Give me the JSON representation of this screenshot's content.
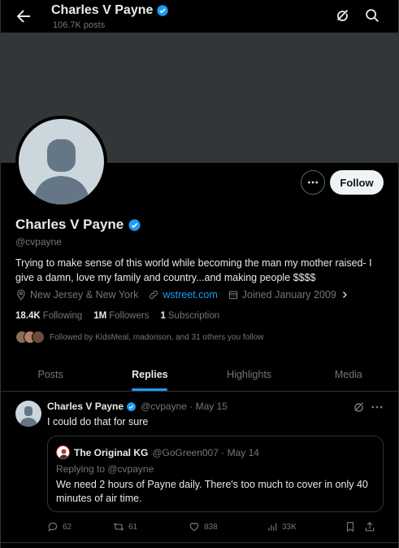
{
  "header": {
    "name": "Charles V Payne",
    "posts": "106.7K posts"
  },
  "profile": {
    "name": "Charles V Payne",
    "handle": "@cvpayne",
    "bio": "Trying to make sense of this world while becoming the man my mother raised- I give a damn, love my family and country...and making people $$$$",
    "location": "New Jersey & New York",
    "website": "wstreet.com",
    "joined": "Joined January 2009",
    "follow_label": "Follow"
  },
  "stats": {
    "following_count": "18.4K",
    "following_label": "Following",
    "followers_count": "1M",
    "followers_label": "Followers",
    "subscription_count": "1",
    "subscription_label": "Subscription"
  },
  "followed_by": "Followed by KidsMeal, madorison, and 31 others you follow",
  "tabs": [
    {
      "label": "Posts"
    },
    {
      "label": "Replies"
    },
    {
      "label": "Highlights"
    },
    {
      "label": "Media"
    }
  ],
  "tweet": {
    "name": "Charles V Payne",
    "handle_date": "@cvpayne · May 15",
    "text": "I could do that for sure",
    "quote": {
      "name": "The Original KG",
      "handle_date": "@GoGreen007 · May 14",
      "replying_label": "Replying to ",
      "replying_handle": "@cvpayne",
      "text": "We need 2 hours of Payne daily.  There's too much to cover in only 40 minutes of air time."
    },
    "actions": {
      "replies": "62",
      "reposts": "61",
      "likes": "838",
      "views": "33K"
    }
  },
  "colors": {
    "accent": "#1d9bf0",
    "verified": "#1d9bf0",
    "background": "#000000",
    "muted": "#71767b"
  },
  "icons": [
    "back-arrow-icon",
    "verified-badge-icon",
    "grok-icon",
    "search-icon",
    "more-icon",
    "location-icon",
    "link-icon",
    "calendar-icon",
    "chevron-right-icon",
    "reply-icon",
    "repost-icon",
    "like-icon",
    "views-icon",
    "bookmark-icon",
    "share-icon"
  ]
}
